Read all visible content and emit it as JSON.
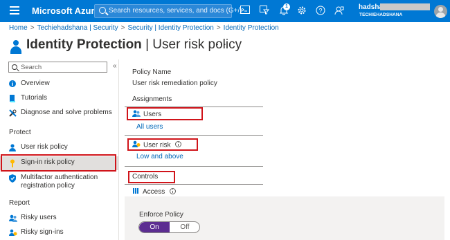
{
  "topbar": {
    "brand": "Microsoft Azure",
    "search_placeholder": "Search resources, services, and docs (G+/)",
    "notification_count": "1",
    "account_name": "hadshana",
    "tenant": "TECHIEHADSHANA",
    "icons": [
      "menu-icon",
      "cloud-shell-icon",
      "directory-filter-icon",
      "notifications-icon",
      "settings-icon",
      "help-icon",
      "feedback-icon"
    ]
  },
  "breadcrumb": [
    "Home",
    "Techiehadshana | Security",
    "Security | Identity Protection",
    "Identity Protection"
  ],
  "page": {
    "title_bold": "Identity Protection",
    "title_rest": " | User risk policy",
    "more": "···"
  },
  "sidebar": {
    "search_placeholder": "Search",
    "collapse": "«",
    "items_top": [
      {
        "label": "Overview",
        "icon": "info-icon"
      },
      {
        "label": "Tutorials",
        "icon": "book-icon"
      },
      {
        "label": "Diagnose and solve problems",
        "icon": "wrench-icon"
      }
    ],
    "section_protect": "Protect",
    "items_protect": [
      {
        "label": "User risk policy",
        "icon": "user-icon"
      },
      {
        "label": "Sign-in risk policy",
        "icon": "key-icon"
      },
      {
        "label": "Multifactor authentication",
        "label2": "registration policy",
        "icon": "shield-icon"
      }
    ],
    "section_report": "Report",
    "items_report": [
      {
        "label": "Risky users",
        "icon": "users-icon"
      },
      {
        "label": "Risky sign-ins",
        "icon": "signins-icon"
      }
    ]
  },
  "policy": {
    "name_label": "Policy Name",
    "name_value": "User risk remediation policy",
    "assignments": "Assignments",
    "users_label": "Users",
    "users_value": "All users",
    "user_risk_label": "User risk",
    "user_risk_value": "Low and above",
    "controls": "Controls",
    "access_label": "Access",
    "enforce_label": "Enforce Policy",
    "toggle_on": "On",
    "toggle_off": "Off"
  },
  "colors": {
    "azure_blue": "#0078d4",
    "highlight_red": "#d0141a",
    "toggle_purple": "#5c2d91"
  }
}
